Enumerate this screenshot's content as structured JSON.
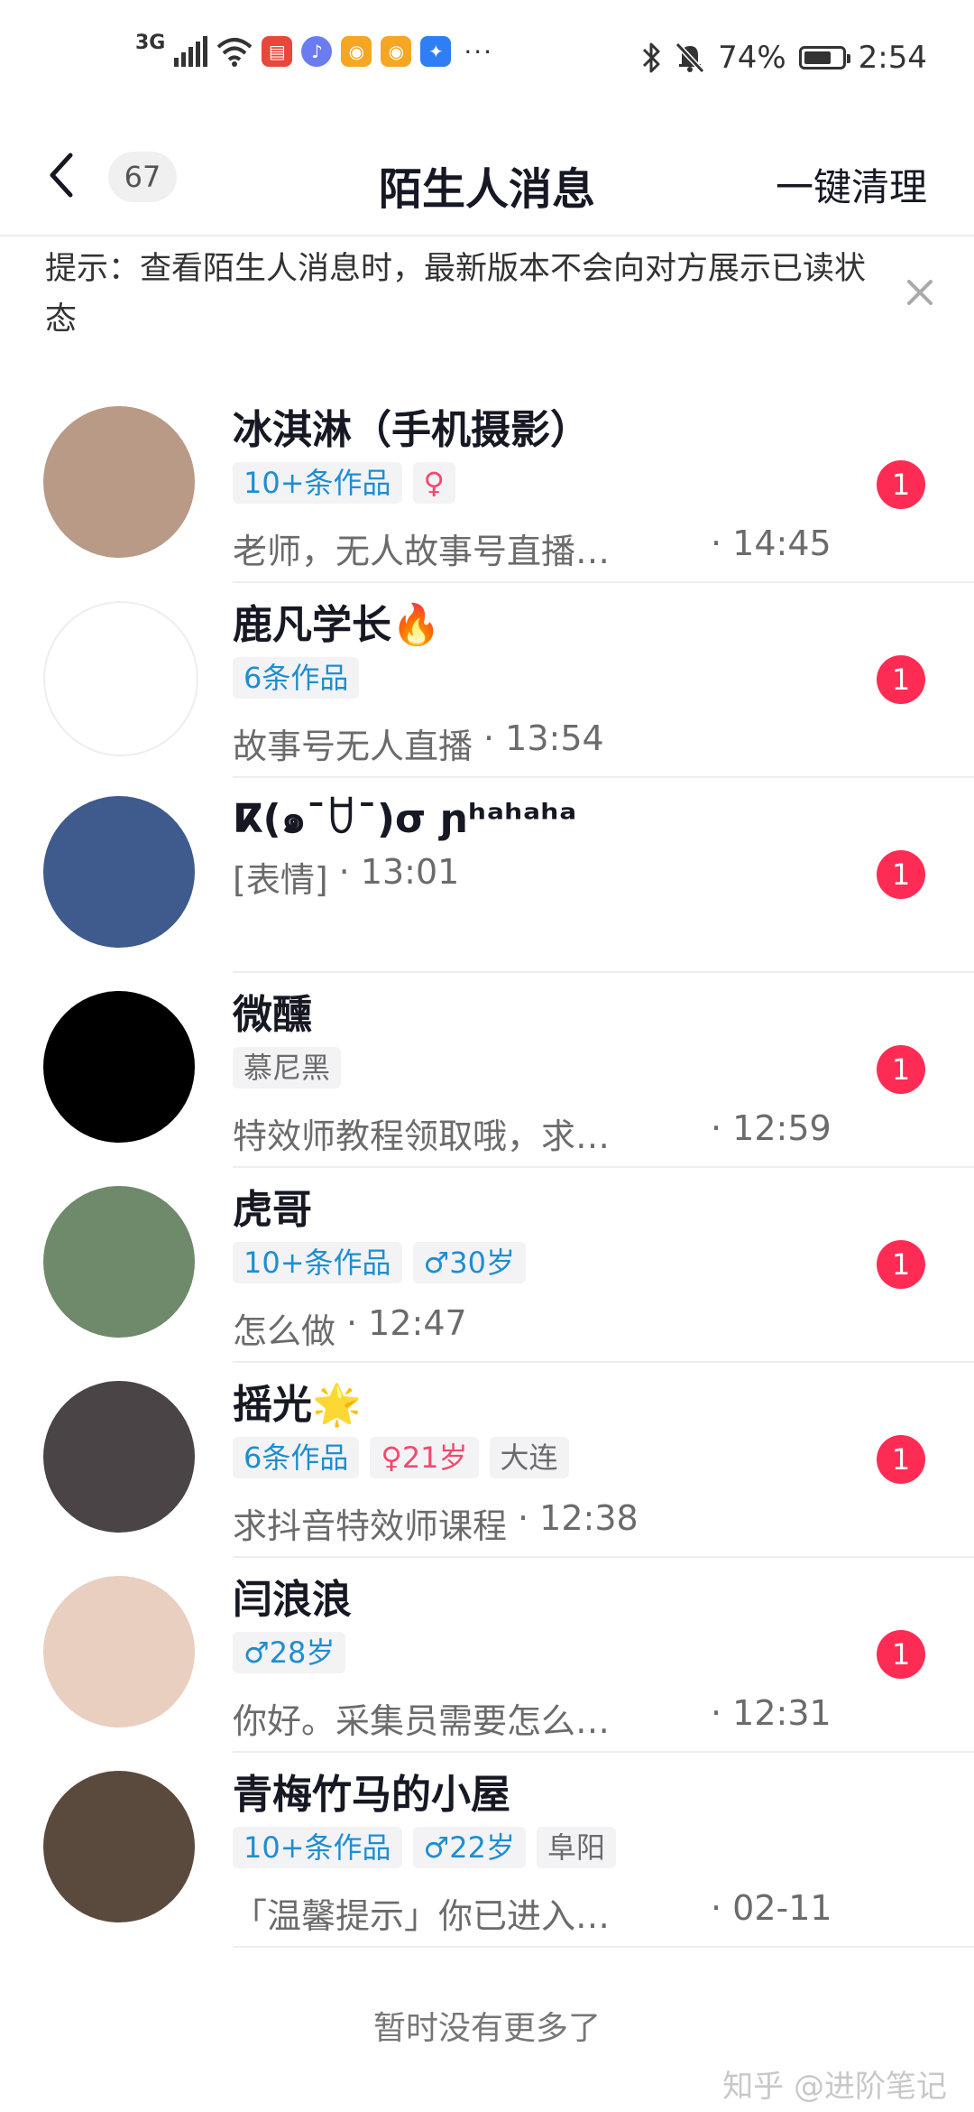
{
  "status_bar": {
    "network": "3G",
    "battery_percent": "74%",
    "battery_level": 0.74,
    "time": "2:54",
    "app_icons": [
      "book-icon",
      "music-icon",
      "weibo-icon",
      "weibo-icon",
      "bulb-icon"
    ],
    "overflow": "···"
  },
  "nav": {
    "count": "67",
    "title": "陌生人消息",
    "action": "一键清理"
  },
  "tip": {
    "text": "提示：查看陌生人消息时，最新版本不会向对方展示已读状态"
  },
  "messages": [
    {
      "name": "冰淇淋（手机摄影）",
      "tags": [
        {
          "text": "10+条作品",
          "kind": "works"
        },
        {
          "text": "♀",
          "kind": "female"
        }
      ],
      "preview": "老师，无人故事号直播…",
      "time": "· 14:45",
      "unread": "1",
      "avatar_color": "#b89a86"
    },
    {
      "name": "鹿凡学长🔥",
      "tags": [
        {
          "text": "6条作品",
          "kind": "works"
        }
      ],
      "preview": "故事号无人直播",
      "time": "· 13:54",
      "unread": "1",
      "avatar_color": "#ffffff"
    },
    {
      "name": "ⴽ(๑¯ꇴ¯)σ ɲʰᵃʰᵃʰᵃ",
      "tags": [],
      "preview": "[表情]",
      "time": "· 13:01",
      "unread": "1",
      "avatar_color": "#3f5a8c"
    },
    {
      "name": "微醺",
      "tags": [
        {
          "text": "慕尼黑",
          "kind": "plain"
        }
      ],
      "preview": "特效师教程领取哦，求…",
      "time": "· 12:59",
      "unread": "1",
      "avatar_color": "#000000"
    },
    {
      "name": "虎哥",
      "tags": [
        {
          "text": "10+条作品",
          "kind": "works"
        },
        {
          "text": "♂30岁",
          "kind": "male"
        }
      ],
      "preview": "怎么做",
      "time": "· 12:47",
      "unread": "1",
      "avatar_color": "#6f8a6a"
    },
    {
      "name": "摇光🌟",
      "tags": [
        {
          "text": "6条作品",
          "kind": "works"
        },
        {
          "text": "♀21岁",
          "kind": "female"
        },
        {
          "text": "大连",
          "kind": "plain"
        }
      ],
      "preview": "求抖音特效师课程",
      "time": "· 12:38",
      "unread": "1",
      "avatar_color": "#4a4446"
    },
    {
      "name": "闫浪浪",
      "tags": [
        {
          "text": "♂28岁",
          "kind": "male"
        }
      ],
      "preview": "你好。采集员需要怎么…",
      "time": "· 12:31",
      "unread": "1",
      "avatar_color": "#e8cfc0"
    },
    {
      "name": "青梅竹马的小屋",
      "tags": [
        {
          "text": "10+条作品",
          "kind": "works"
        },
        {
          "text": "♂22岁",
          "kind": "male"
        },
        {
          "text": "阜阳",
          "kind": "plain"
        }
      ],
      "preview": "「温馨提示」你已进入…",
      "time": "· 02-11",
      "unread": "",
      "avatar_color": "#5a4a3e"
    }
  ],
  "footer": "暂时没有更多了",
  "watermark": "知乎 @进阶笔记"
}
